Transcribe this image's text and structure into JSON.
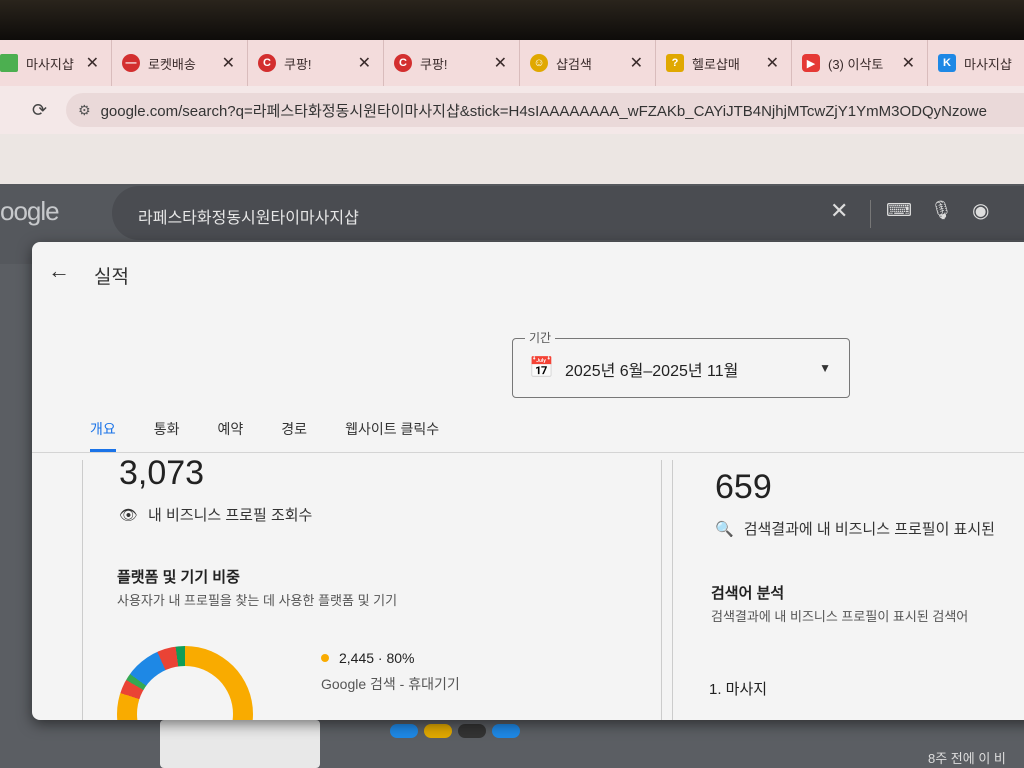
{
  "tabs": [
    {
      "label": "마사지샵",
      "icon": "green-square-icon",
      "color": "#4caf50"
    },
    {
      "label": "로켓배송",
      "icon": "no-entry-icon",
      "color": "#d32f2f"
    },
    {
      "label": "쿠팡!",
      "icon": "coupang-icon",
      "color": "#d32f2f"
    },
    {
      "label": "쿠팡!",
      "icon": "coupang-icon",
      "color": "#d32f2f"
    },
    {
      "label": "샵검색",
      "icon": "smile-icon",
      "color": "#e0a800"
    },
    {
      "label": "헬로샵매",
      "icon": "help-icon",
      "color": "#e0a800"
    },
    {
      "label": "(3) 이삭토",
      "icon": "youtube-icon",
      "color": "#e53935"
    },
    {
      "label": "마사지샵",
      "icon": "k-icon",
      "color": "#1e88e5"
    }
  ],
  "address": {
    "url": "google.com/search?q=라페스타화정동시원타이마사지샵&stick=H4sIAAAAAAAA_wFZAKb_CAYiJTB4NjhjMTcwZjY1YmM3ODQyNzowe"
  },
  "google": {
    "logo": "oogle",
    "query": "라페스타화정동시원타이마사지샵"
  },
  "dialog": {
    "title": "실적",
    "period": {
      "legend": "기간",
      "value": "2025년 6월–2025년 11월"
    },
    "tabs": [
      "개요",
      "통화",
      "예약",
      "경로",
      "웹사이트 클릭수"
    ],
    "profile_views": {
      "value": "3,073",
      "label": "내 비즈니스 프로필 조회수"
    },
    "platform": {
      "title": "플랫폼 및 기기 비중",
      "desc": "사용자가 내 프로필을 찾는 데 사용한 플랫폼 및 기기",
      "legend_value": "2,445 · 80%",
      "legend_label": "Google 검색 - 휴대기기",
      "legend_color": "#f9ab00"
    },
    "search_appearances": {
      "value": "659",
      "label": "검색결과에 내 비즈니스 프로필이 표시된"
    },
    "keywords": {
      "title": "검색어 분석",
      "desc": "검색결과에 내 비즈니스 프로필이 표시된 검색어",
      "items": [
        "1.   마사지"
      ]
    }
  },
  "background": {
    "footer_text": "8주 전에 이 비"
  }
}
